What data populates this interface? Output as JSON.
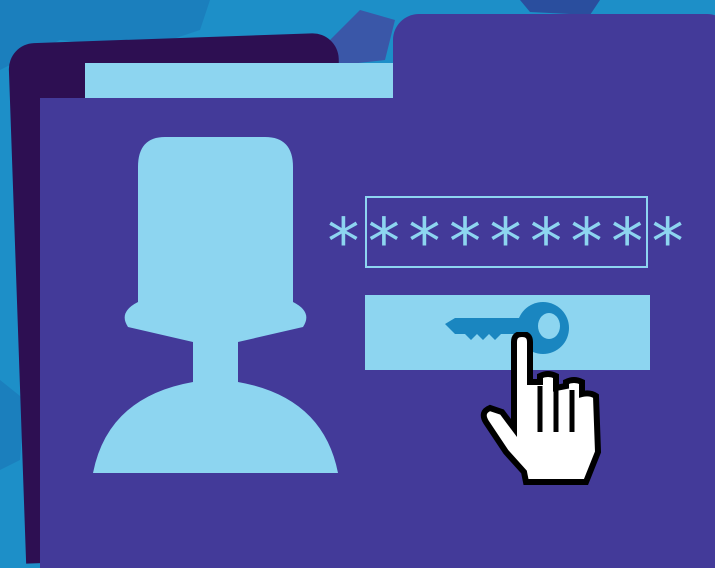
{
  "login": {
    "password_mask": "*********"
  },
  "icons": {
    "avatar": "user-silhouette",
    "key": "key",
    "cursor": "hand-pointer"
  },
  "colors": {
    "background": "#1d8fc8",
    "folder_front": "#433a99",
    "folder_back": "#2d0f52",
    "light_accent": "#8dd5f0",
    "key": "#1a86c0",
    "cursor_fill": "#ffffff",
    "cursor_outline": "#000000"
  }
}
